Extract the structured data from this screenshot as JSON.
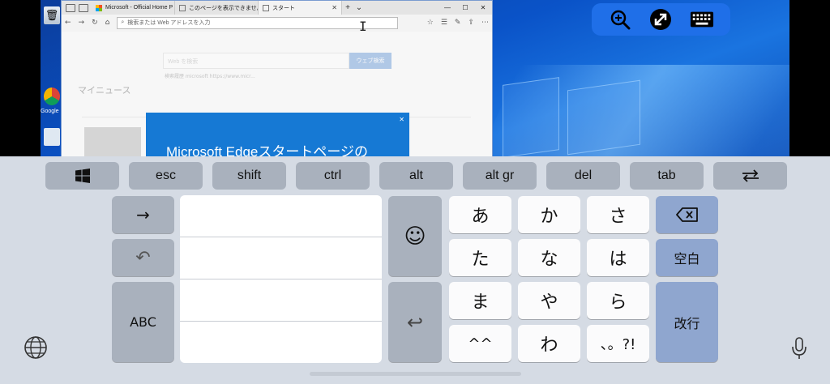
{
  "browser": {
    "tabs": [
      {
        "label": "Microsoft - Official Home P"
      },
      {
        "label": "このページを表示できません"
      },
      {
        "label": "スタート"
      }
    ],
    "address_placeholder": "検索または Web アドレスを入力"
  },
  "edge_page": {
    "search_placeholder": "Web を検索",
    "search_button": "ウェブ検索",
    "links": "検索履歴   microsoft   https://www.micr...",
    "my_news": "マイニュース",
    "popup_title": "Microsoft Edgeスタートページの"
  },
  "desktop": {
    "chrome_label": "Google"
  },
  "overlay_toolbar": {
    "items": [
      "zoom-in",
      "remote-desktop",
      "keyboard"
    ]
  },
  "keyboard": {
    "function_keys": [
      {
        "label": ""
      },
      {
        "label": "esc"
      },
      {
        "label": "shift"
      },
      {
        "label": "ctrl"
      },
      {
        "label": "alt"
      },
      {
        "label": "alt gr"
      },
      {
        "label": "del"
      },
      {
        "label": "tab"
      },
      {
        "label": ""
      }
    ],
    "left": {
      "arrow": "→",
      "undo": "↶",
      "abc": "ABC"
    },
    "emoji": "☺",
    "return_symbol": "↩",
    "kana_rows": [
      [
        "あ",
        "か",
        "さ"
      ],
      [
        "た",
        "な",
        "は"
      ],
      [
        "ま",
        "や",
        "ら"
      ],
      [
        "^^",
        "わ",
        "、。?!"
      ]
    ],
    "space_label": "空白",
    "enter_label": "改行"
  },
  "colors": {
    "accent": "#1f6fe8",
    "keyboard_bg": "#d5dbe4",
    "gray_key": "#a9b1bd",
    "blue_key": "#8fa6cf"
  }
}
